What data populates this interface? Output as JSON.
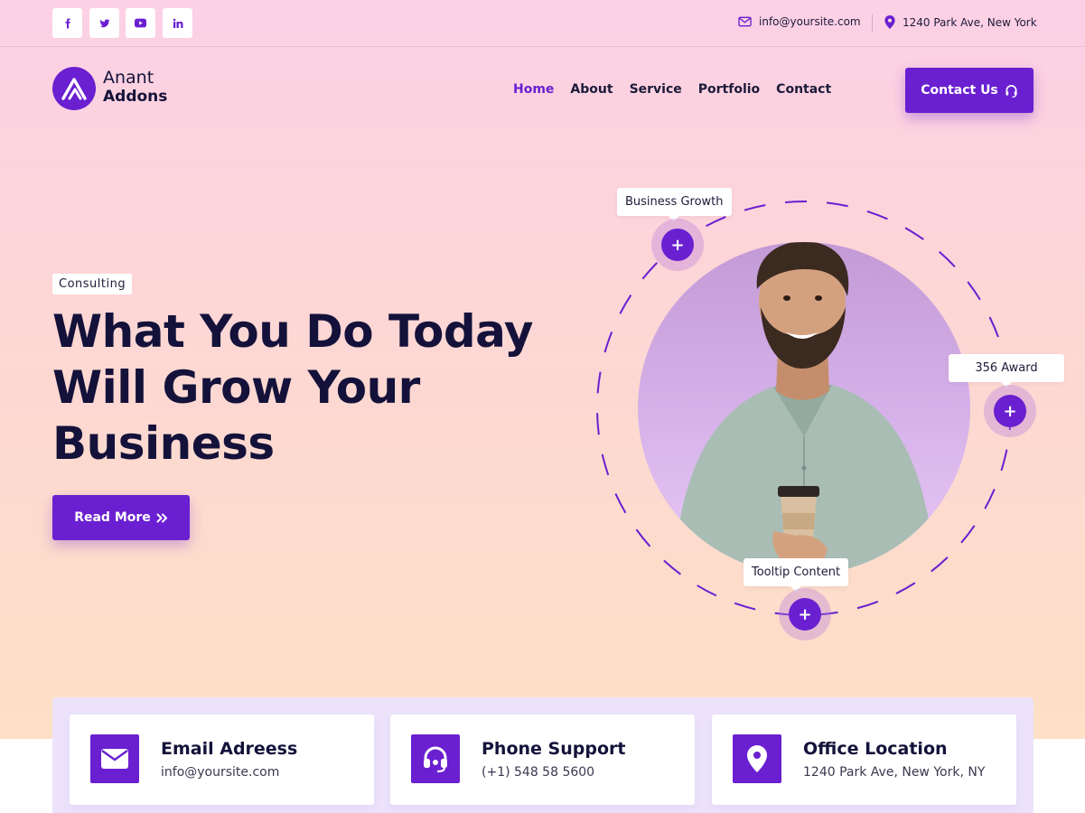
{
  "topbar": {
    "social": [
      {
        "name": "facebook",
        "glyph": "f"
      },
      {
        "name": "twitter",
        "glyph": "t"
      },
      {
        "name": "youtube",
        "glyph": "yt"
      },
      {
        "name": "linkedin",
        "glyph": "in"
      }
    ],
    "email": "info@yoursite.com",
    "address": "1240 Park Ave, New York"
  },
  "brand": {
    "line1": "Anant",
    "line2": "Addons"
  },
  "nav": {
    "items": [
      "Home",
      "About",
      "Service",
      "Portfolio",
      "Contact"
    ],
    "active": "Home"
  },
  "header": {
    "contact_label": "Contact Us"
  },
  "hero": {
    "badge": "Consulting",
    "headline_lines": [
      "What You Do Today",
      "Will Grow Your",
      "Business"
    ],
    "cta_label": "Read More"
  },
  "hotspots": {
    "top": "Business Growth",
    "right": "356 Award",
    "bottom": "Tooltip Content",
    "plus": "+"
  },
  "info_cards": [
    {
      "title": "Email Adreess",
      "value": "info@yoursite.com",
      "icon": "envelope-icon"
    },
    {
      "title": "Phone Support",
      "value": "(+1) 548 58 5600",
      "icon": "headset-icon"
    },
    {
      "title": "Office Location",
      "value": "1240 Park Ave, New York, NY",
      "icon": "map-pin-icon"
    }
  ],
  "colors": {
    "accent": "#6a1fd0",
    "dark_text": "#14123a",
    "hero_top": "#fcd0e6",
    "hero_bottom": "#fde0c6",
    "info_panel": "#ece3fb"
  }
}
